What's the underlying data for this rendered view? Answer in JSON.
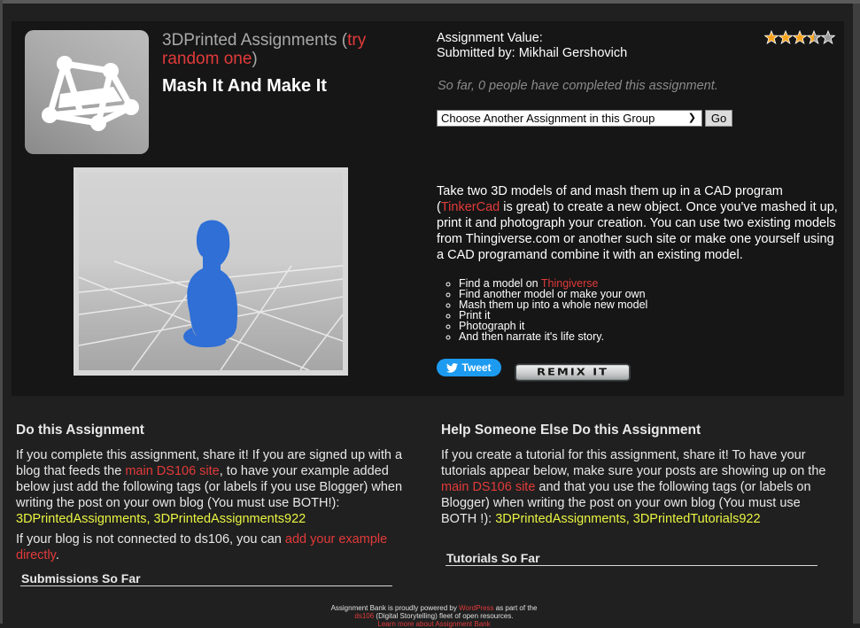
{
  "header": {
    "group_name": "3DPrinted Assignments",
    "random_link": "try random one",
    "title": "Mash It And Make It",
    "group_icon": "network-tetrahedron-icon"
  },
  "meta": {
    "assignment_value_label": "Assignment Value:",
    "submitted_by_label": "Submitted by:",
    "submitted_by": "Mikhail Gershovich",
    "rating": 3.5,
    "rating_max": 5,
    "completed_text": "So far, 0 people have completed this assignment."
  },
  "chooser": {
    "selected": "Choose Another Assignment in this Group",
    "go_label": "Go"
  },
  "photo": {
    "alt": "Blue 3D-printed cat with human head on grid floor"
  },
  "description": {
    "part1": "Take two 3D models of and mash them up in a CAD program (",
    "tinkercad_link": "TinkerCad",
    "part2": " is great) to create a new object. Once you've mashed it up, print it and photograph your creation. You can use two existing models from Thingiverse.com or another such site or make one yourself using a CAD programand combine it with an existing model."
  },
  "steps": [
    {
      "text": "Find a model on ",
      "link": "Thingiverse"
    },
    {
      "text": "Find another model or make your own"
    },
    {
      "text": "Mash them up into a whole new model"
    },
    {
      "text": "Print it"
    },
    {
      "text": "Photograph it"
    },
    {
      "text": "And then narrate it's life story."
    }
  ],
  "share": {
    "tweet_label": "Tweet",
    "remix_label": "REMIX IT"
  },
  "do_assignment": {
    "heading": "Do this Assignment",
    "p1_a": "If you complete this assignment, share it! If you are signed up with a blog that feeds the ",
    "p1_link": "main DS106 site",
    "p1_b": ", to have your example added below just add the following tags (or labels if you use Blogger) when writing the post on your own blog (You must use BOTH!): ",
    "p1_tags": "3DPrintedAssignments, 3DPrintedAssignments922",
    "p2_a": "If your blog is not connected to ds106, you can ",
    "p2_link": "add your example directly",
    "p2_b": ".",
    "submissions_heading": "Submissions So Far"
  },
  "help_assignment": {
    "heading": "Help Someone Else Do this Assignment",
    "p1_a": "If you create a tutorial for this assignment, share it! To have your tutorials appear below, make sure your posts are showing up on the ",
    "p1_link": "main DS106 site",
    "p1_b": " and that you use the following tags (or labels on Blogger) when writing the post on your own blog (You must use BOTH !): ",
    "p1_tags": "3DPrintedAssignments, 3DPrintedTutorials922",
    "tutorials_heading": "Tutorials So Far"
  },
  "footer": {
    "line1_a": "Assignment Bank is proudly powered by ",
    "wordpress_link": "WordPress",
    "line1_b": " as part of the",
    "ds106_link": "ds106",
    "line2": " (Digital Storytelling) fleet of open resources.",
    "learn_more_link": "Learn more about Assignment Bank"
  },
  "colors": {
    "link": "#e23a3a",
    "tag": "#e9f542",
    "tweet": "#1d9bf0",
    "star_on": "#f7a21b",
    "star_off": "#9a9a9a"
  }
}
